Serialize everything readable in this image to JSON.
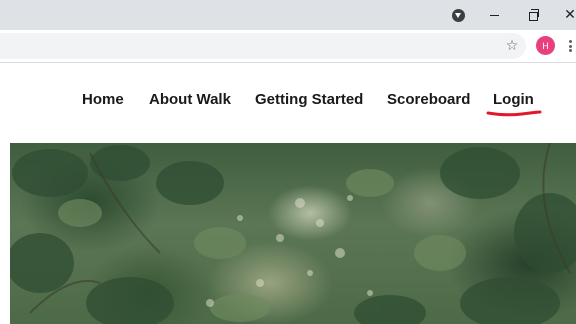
{
  "browser": {
    "profile_initial": "H",
    "close_glyph": "✕",
    "star_glyph": "☆",
    "icons": [
      "profile-dropdown-icon",
      "minimize-icon",
      "restore-icon",
      "close-icon",
      "star-icon",
      "menu-icon"
    ]
  },
  "nav": {
    "items": [
      {
        "label": "Home"
      },
      {
        "label": "About Walk"
      },
      {
        "label": "Getting Started"
      },
      {
        "label": "Scoreboard"
      },
      {
        "label": "Login"
      }
    ]
  },
  "colors": {
    "titlebar": "#dee1e6",
    "avatar": "#e8407f",
    "annotation": "#e0182a",
    "nav_text": "#1a1a1a"
  }
}
